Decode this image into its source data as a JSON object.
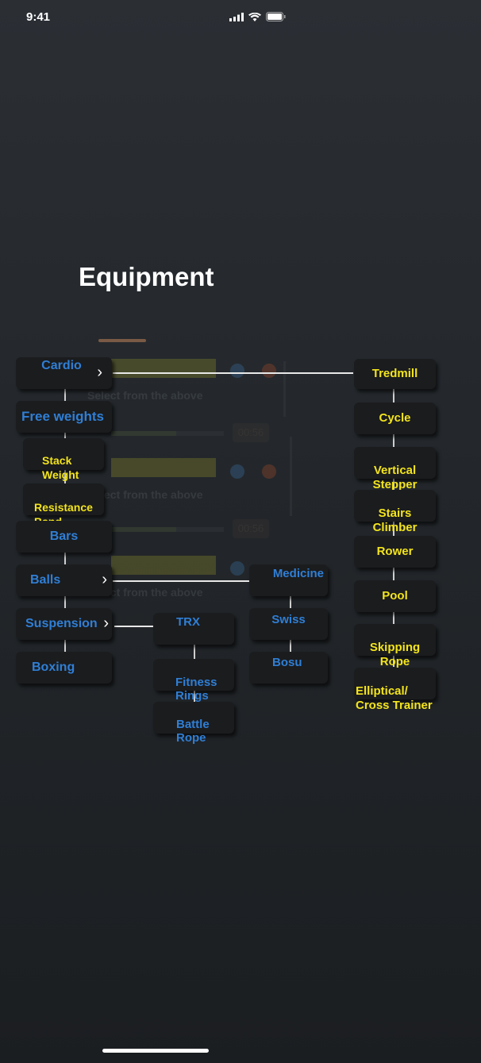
{
  "status": {
    "time": "9:41"
  },
  "title": "Equipment",
  "background": {
    "hint": "Select from the above",
    "timer": "00:56"
  },
  "categories": {
    "cardio": "Cardio",
    "free_weights": "Free weights",
    "stack_weight": "Stack\nWeight",
    "resistance_band": "Resistance\nBand",
    "bars": "Bars",
    "balls": "Balls",
    "suspension": "Suspension",
    "boxing": "Boxing"
  },
  "cardio_items": {
    "treadmill": "Tredmill",
    "cycle": "Cycle",
    "vertical_stepper": "Vertical\nStepper",
    "stairs_climber": "Stairs\nClimber",
    "rower": "Rower",
    "pool": "Pool",
    "skipping_rope": "Skipping\nRope",
    "elliptical": "Elliptical/\nCross Trainer"
  },
  "ball_items": {
    "medicine": "Medicine",
    "swiss": "Swiss",
    "bosu": "Bosu"
  },
  "suspension_items": {
    "trx": "TRX",
    "fitness_rings": "Fitness\nRings",
    "battle_rope": "Battle\nRope"
  },
  "colors": {
    "category_text": "#2f7fd6",
    "sub_text": "#f3e41c",
    "node_bg": "#1b1c1e"
  },
  "icons": [
    "signal-icon",
    "wifi-icon",
    "battery-icon",
    "chevron-right-icon"
  ]
}
